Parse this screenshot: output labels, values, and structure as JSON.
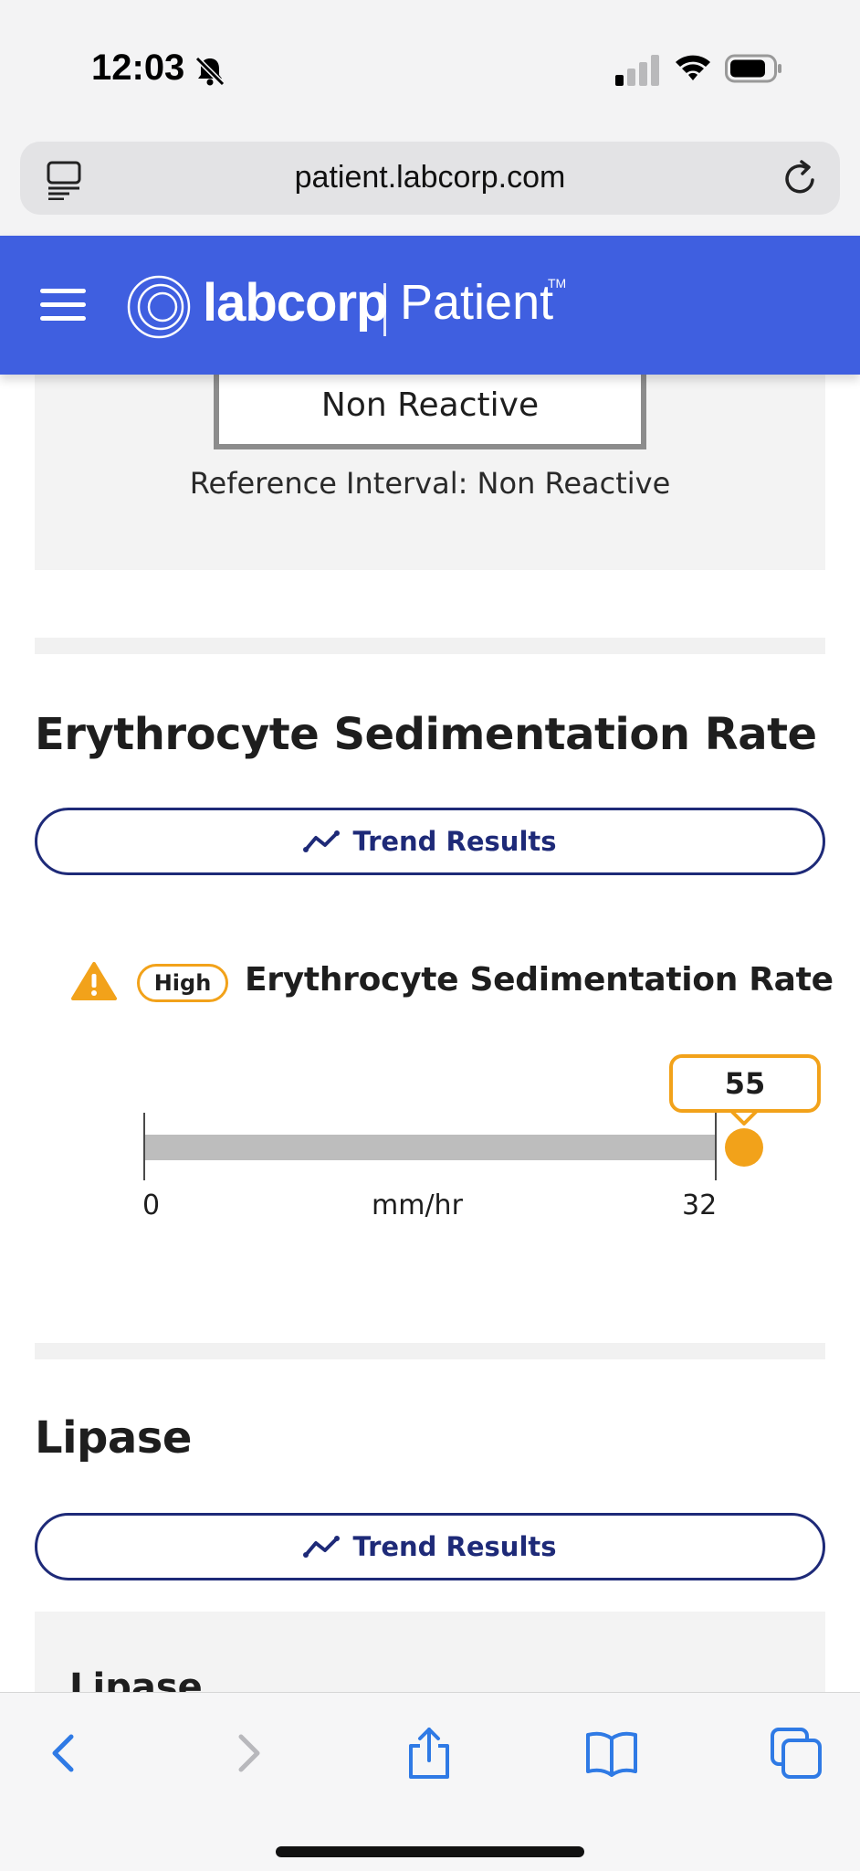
{
  "status_bar": {
    "time": "12:03"
  },
  "browser": {
    "url": "patient.labcorp.com"
  },
  "header": {
    "brand": "labcorp",
    "brand_sub": "Patient",
    "trademark": "TM"
  },
  "previous_result": {
    "value": "Non Reactive",
    "reference_interval": "Reference Interval: Non Reactive"
  },
  "esr_section": {
    "title": "Erythrocyte Sedimentation Rate",
    "trend_button": "Trend Results",
    "flag": "High",
    "test_name": "Erythrocyte Sedimentation Rate",
    "range": {
      "min": "0",
      "max": "32",
      "unit": "mm/hr",
      "value": "55"
    },
    "chart_values": {
      "min": 0,
      "max": 32,
      "value": 55
    }
  },
  "lipase_section": {
    "title": "Lipase",
    "trend_button": "Trend Results",
    "subtitle": "Lipase"
  },
  "colors": {
    "header_blue": "#3f5fe0",
    "accent_navy": "#1e2a78",
    "high_orange": "#f2a21a",
    "toolbar_blue": "#2f7ae5"
  },
  "icons": [
    "bell-slash-icon",
    "signal-icon",
    "wifi-icon",
    "battery-icon",
    "reader-icon",
    "reload-icon",
    "menu-icon",
    "labcorp-logo-icon",
    "trend-icon",
    "warning-icon",
    "back-icon",
    "forward-icon",
    "share-icon",
    "bookmarks-icon",
    "tabs-icon"
  ]
}
